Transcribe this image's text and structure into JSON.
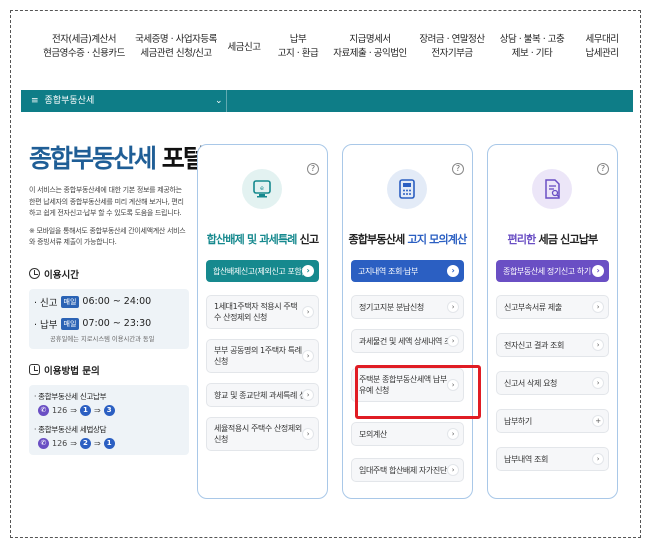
{
  "topnav": [
    {
      "line1": "전자(세금)계산서",
      "line2": "현금영수증 · 신용카드"
    },
    {
      "line1": "국세증명 · 사업자등록",
      "line2": "세금관련 신청/신고"
    },
    {
      "line1": "세금신고",
      "line2": ""
    },
    {
      "line1": "납부",
      "line2": "고지 · 환급"
    },
    {
      "line1": "지급명세서",
      "line2": "자료제출 · 공익법인"
    },
    {
      "line1": "장려금 · 연말정산",
      "line2": "전자기부금"
    },
    {
      "line1": "상담 · 불복 · 고충",
      "line2": "제보 · 기타"
    },
    {
      "line1": "세무대리",
      "line2": "납세관리"
    }
  ],
  "breadcrumb": {
    "menu_glyph": "≡",
    "label": "종합부동산세",
    "chevron": "⌄"
  },
  "left": {
    "title_main": "종합부동산세",
    "title_sub": "포털",
    "desc": "이 서비스는 종합부동산세에 대한 기본 정보를 제공하는 한편 납세자의 종합부동산세를 미리 계산해 보거나, 편리하고 쉽게 전자신고·납부 할 수 있도록 도움을 드립니다.",
    "desc2": "※ 모바일을 통해서도 종합부동산세 간이세액계산 서비스와 증빙서류 제출이 가능합니다.",
    "hours_title": "이용시간",
    "hours": [
      {
        "prefix": "· 신고",
        "tag": "매일",
        "time": "06:00 ~ 24:00"
      },
      {
        "prefix": "· 납부",
        "tag": "매일",
        "time": "07:00 ~ 23:30"
      }
    ],
    "hours_note": "공휴일에는 지로시스템 이용시간과 동일",
    "contact_title": "이용방법 문의",
    "contacts": [
      {
        "label": "· 종합부동산세 신고납부",
        "phone": "126",
        "n1": "1",
        "n2": "3"
      },
      {
        "label": "· 종합부동산세 세법상담",
        "phone": "126",
        "n1": "2",
        "n2": "1"
      }
    ]
  },
  "cards": [
    {
      "title_a": "합산배제 및 과세특례",
      "title_b": " 신고",
      "accent": "#16898e",
      "primary": "합산배제신고(제외신고 포함)",
      "items": [
        "1세대1주택자 적용시 주택수 산정제외 신청",
        "부부 공동명의 1주택자 특례 신청",
        "향교 및 종교단체 과세특례 신고",
        "세율적용시 주택수 산정제외 신청"
      ]
    },
    {
      "title_a": "종합부동산세",
      "title_b": " 고지 모의계산",
      "accent": "#2b5fc2",
      "primary": "고지내역 조회·납부",
      "items": [
        "정기고지분 분납신청",
        "과세물건 및 세액 상세내역 조회",
        "주택분 종합부동산세액 납부유예 신청",
        "모의계산",
        "임대주택 합산배제 자가진단"
      ]
    },
    {
      "title_a": "편리한",
      "title_b": " 세금 신고납부",
      "accent": "#6a4fc4",
      "primary": "종합부동산세 정기신고 하기",
      "items": [
        "신고부속서류 제출",
        "전자신고 결과 조회",
        "신고서 삭제 요청",
        "납부하기",
        "납부내역 조회"
      ]
    }
  ]
}
